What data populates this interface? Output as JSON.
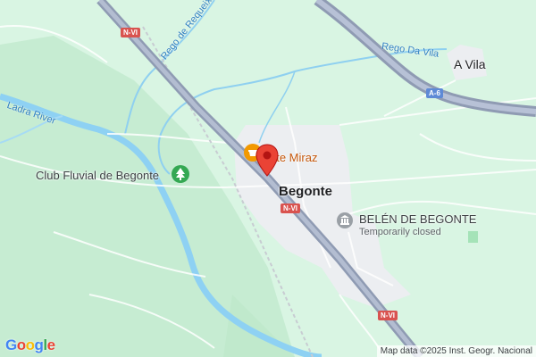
{
  "places": {
    "a_vila": "A Vila",
    "begonte": "Begonte"
  },
  "water": {
    "ladra_river": "Ladra River",
    "rego_requeixo": "Rego de Requeixo",
    "rego_da_vila": "Rego Da Vila"
  },
  "roads": {
    "nvi": "N-VI",
    "a6": "A-6"
  },
  "pois": {
    "club_fluvial": "Club Fluvial de Begonte",
    "restaurant": "nte Miraz",
    "belen_title": "BELÉN DE BEGONTE",
    "belen_status": "Temporarily closed"
  },
  "icons": {
    "park": "tree-icon",
    "restaurant": "restaurant-icon",
    "museum": "landmark-icon",
    "pin": "red-location-pin"
  },
  "colors": {
    "land": "#d9f5e3",
    "park": "#c3ecd0",
    "urban": "#ecedf0",
    "water": "#8ed1f3",
    "highway": "#9aa6bd",
    "pin": "#ea4335"
  },
  "footer": {
    "attribution": "Map data ©2025 Inst. Geogr. Nacional",
    "logo": "Google"
  }
}
